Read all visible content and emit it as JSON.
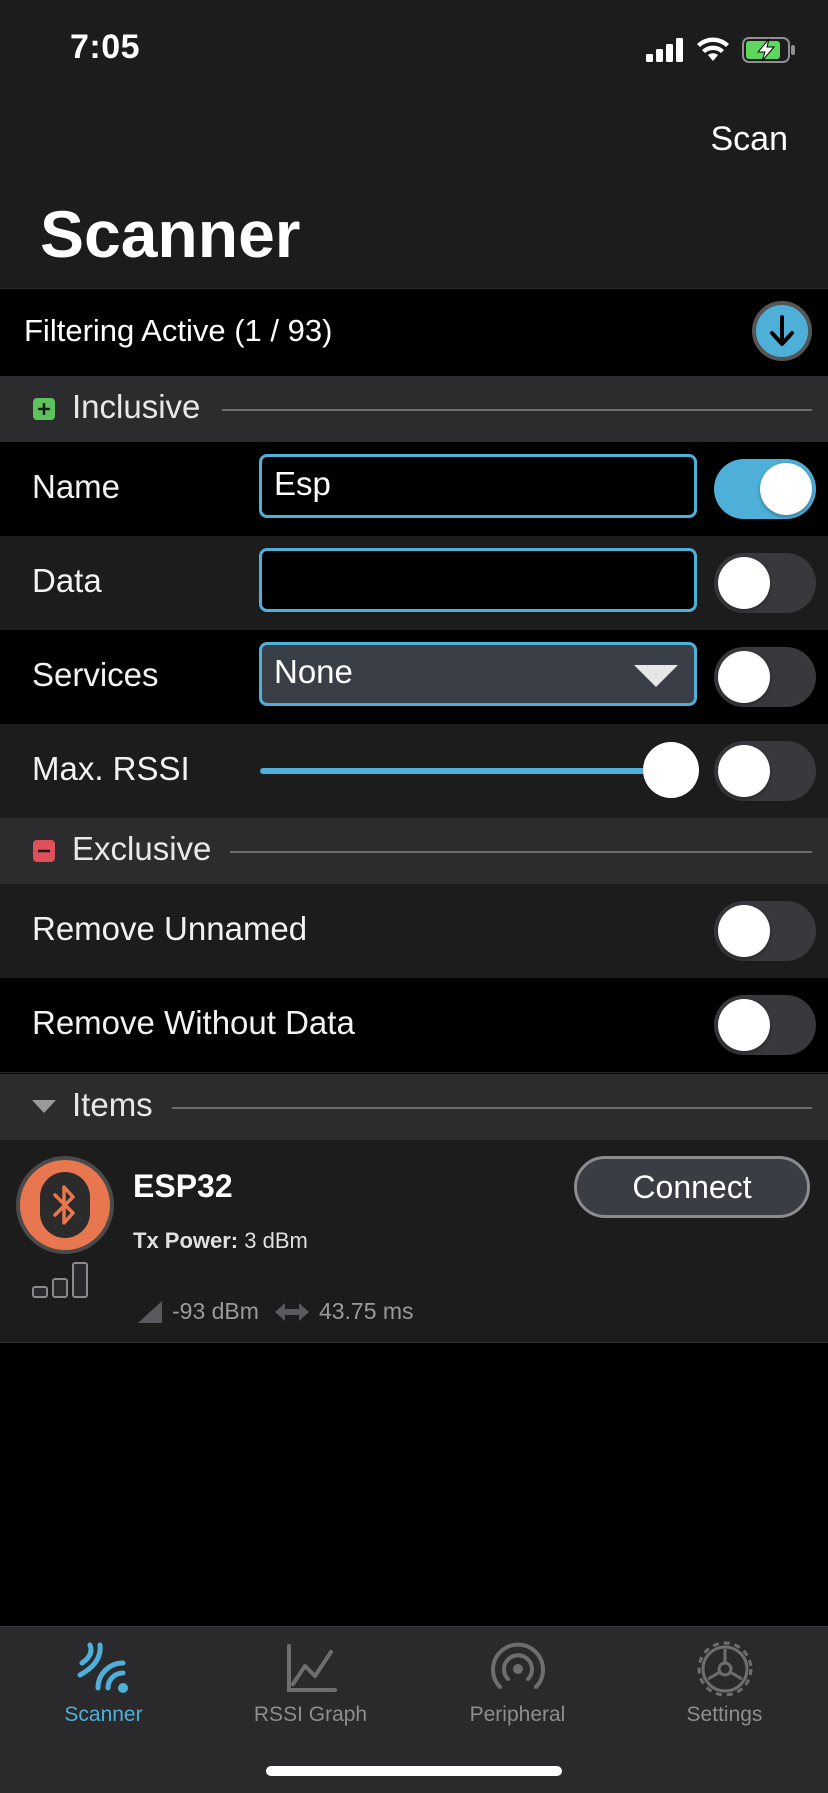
{
  "status_bar": {
    "time": "7:05"
  },
  "nav": {
    "scan_label": "Scan",
    "title": "Scanner"
  },
  "filter": {
    "status_text": "Filtering Active (1 / 93)"
  },
  "inclusive": {
    "header": "Inclusive",
    "rows": {
      "name": {
        "label": "Name",
        "value": "Esp",
        "enabled": true
      },
      "data": {
        "label": "Data",
        "value": "",
        "enabled": false
      },
      "services": {
        "label": "Services",
        "value": "None",
        "enabled": false
      },
      "rssi": {
        "label": "Max. RSSI",
        "level": 0.92,
        "enabled": false
      }
    }
  },
  "exclusive": {
    "header": "Exclusive",
    "rows": {
      "unnamed": {
        "label": "Remove Unnamed",
        "enabled": false
      },
      "without_data": {
        "label": "Remove Without Data",
        "enabled": false
      }
    }
  },
  "items": {
    "header": "Items",
    "list": [
      {
        "name": "ESP32",
        "tx_label": "Tx Power:",
        "tx_value": "3 dBm",
        "rssi": "-93 dBm",
        "interval": "43.75 ms",
        "connect_label": "Connect"
      }
    ]
  },
  "tabs": [
    {
      "label": "Scanner",
      "icon": "scanner-icon",
      "active": true
    },
    {
      "label": "RSSI Graph",
      "icon": "graph-icon",
      "active": false
    },
    {
      "label": "Peripheral",
      "icon": "broadcast-icon",
      "active": false
    },
    {
      "label": "Settings",
      "icon": "gear-icon",
      "active": false
    }
  ],
  "colors": {
    "accent": "#4eb0d8",
    "inclusive": "#5cc45a",
    "exclusive": "#e0505a",
    "bt_avatar": "#e8764f"
  }
}
